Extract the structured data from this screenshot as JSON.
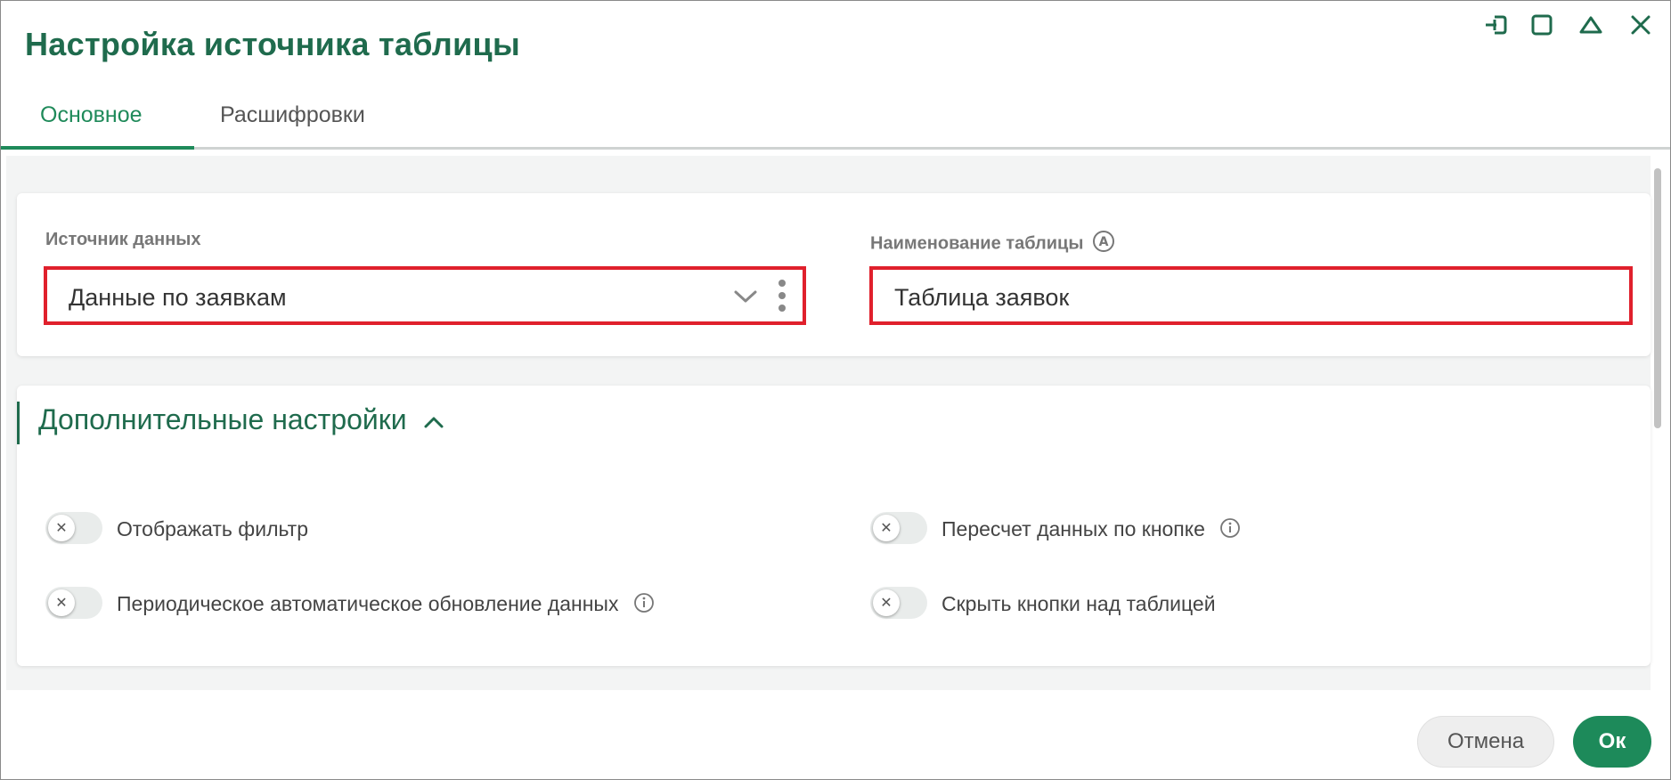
{
  "dialog": {
    "title": "Настройка источника таблицы",
    "window_controls": [
      "exit-icon",
      "maximize-icon",
      "collapse-icon",
      "close-icon"
    ]
  },
  "tabs": [
    {
      "label": "Основное",
      "active": true
    },
    {
      "label": "Расшифровки",
      "active": false
    }
  ],
  "main": {
    "data_source": {
      "label": "Источник данных",
      "value": "Данные по заявкам"
    },
    "table_name": {
      "label": "Наименование таблицы",
      "value": "Таблица заявок",
      "badge_icon": "auto-letter-icon"
    }
  },
  "advanced": {
    "title": "Дополнительные настройки",
    "expanded": true,
    "toggles": [
      {
        "label": "Отображать фильтр",
        "on": false,
        "info": false
      },
      {
        "label": "Пересчет данных по кнопке",
        "on": false,
        "info": true
      },
      {
        "label": "Периодическое автоматическое обновление данных",
        "on": false,
        "info": true
      },
      {
        "label": "Скрыть кнопки над таблицей",
        "on": false,
        "info": false
      }
    ]
  },
  "footer": {
    "cancel_label": "Отмена",
    "ok_label": "Ок"
  },
  "colors": {
    "accent": "#1f6b4d",
    "primary_button": "#1d8a5a",
    "highlight_border": "#e0202c"
  }
}
